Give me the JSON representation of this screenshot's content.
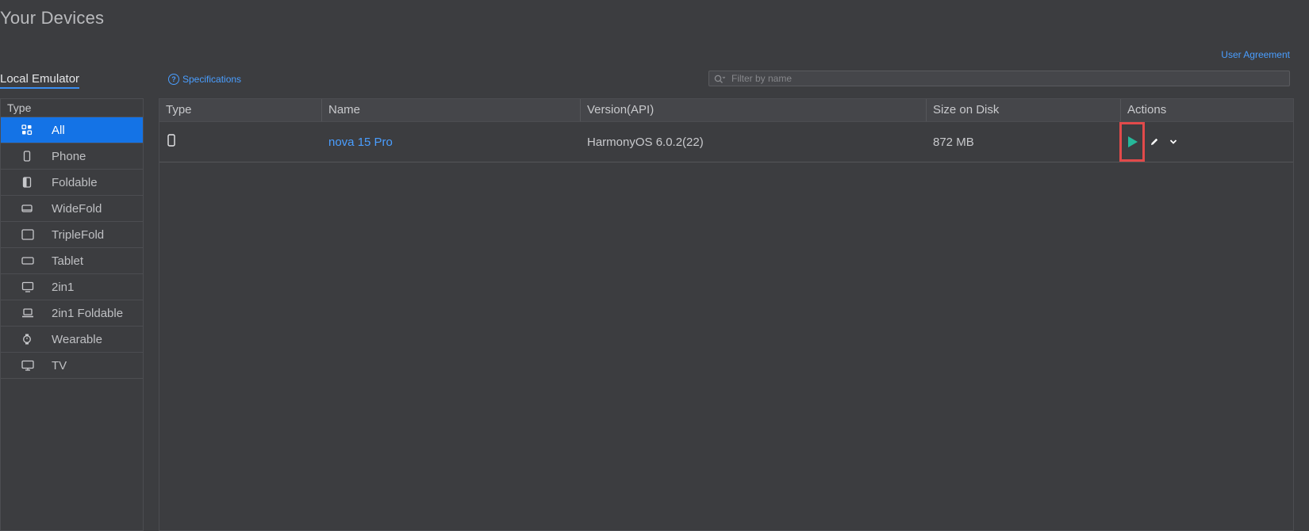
{
  "page": {
    "title": "Your Devices",
    "user_agreement": "User Agreement",
    "tab_local": "Local Emulator",
    "specifications": "Specifications",
    "filter_placeholder": "Filter by name"
  },
  "sidebar": {
    "header": "Type",
    "items": [
      {
        "label": "All",
        "icon": "grid-icon",
        "active": true
      },
      {
        "label": "Phone",
        "icon": "phone-icon"
      },
      {
        "label": "Foldable",
        "icon": "foldable-icon"
      },
      {
        "label": "WideFold",
        "icon": "widefold-icon"
      },
      {
        "label": "TripleFold",
        "icon": "triplefold-icon"
      },
      {
        "label": "Tablet",
        "icon": "tablet-icon"
      },
      {
        "label": "2in1",
        "icon": "monitor-icon"
      },
      {
        "label": "2in1 Foldable",
        "icon": "laptop-icon"
      },
      {
        "label": "Wearable",
        "icon": "watch-icon"
      },
      {
        "label": "TV",
        "icon": "tv-icon"
      }
    ]
  },
  "table": {
    "columns": [
      "Type",
      "Name",
      "Version(API)",
      "Size on Disk",
      "Actions"
    ],
    "rows": [
      {
        "type_icon": "phone-icon",
        "name": "nova 15 Pro",
        "version": "HarmonyOS 6.0.2(22)",
        "size": "872 MB"
      }
    ]
  },
  "colors": {
    "accent": "#1473e6",
    "link": "#4a9eff",
    "run": "#26b89a",
    "highlight": "#e24a4a",
    "background": "#3c3d40"
  }
}
